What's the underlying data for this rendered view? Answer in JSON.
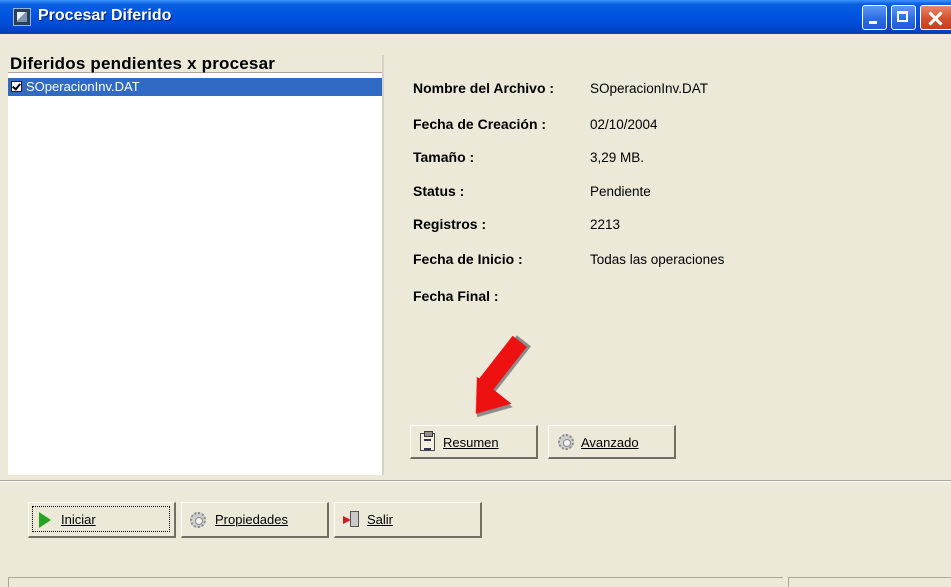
{
  "window": {
    "title": "Procesar Diferido"
  },
  "left_panel": {
    "header": "Diferidos pendientes x procesar",
    "items": [
      {
        "label": "SOperacionInv.DAT",
        "checked": true,
        "selected": true
      }
    ]
  },
  "details": [
    {
      "label": "Nombre del Archivo :",
      "value": "SOperacionInv.DAT"
    },
    {
      "label": "Fecha de Creación :",
      "value": "02/10/2004"
    },
    {
      "label": "Tamaño :",
      "value": "3,29 MB."
    },
    {
      "label": "Status :",
      "value": "Pendiente"
    },
    {
      "label": "Registros :",
      "value": "2213"
    },
    {
      "label": "Fecha de Inicio :",
      "value": "Todas las operaciones"
    },
    {
      "label": "Fecha Final :",
      "value": ""
    }
  ],
  "detail_buttons": {
    "resumen": "Resumen",
    "avanzado": "Avanzado"
  },
  "bottom_buttons": {
    "iniciar": "Iniciar",
    "propiedades": "Propiedades",
    "salir": "Salir"
  },
  "colors": {
    "titlebar": "#0054e3",
    "selection": "#316ac5",
    "annotation_arrow": "#ee1111"
  }
}
